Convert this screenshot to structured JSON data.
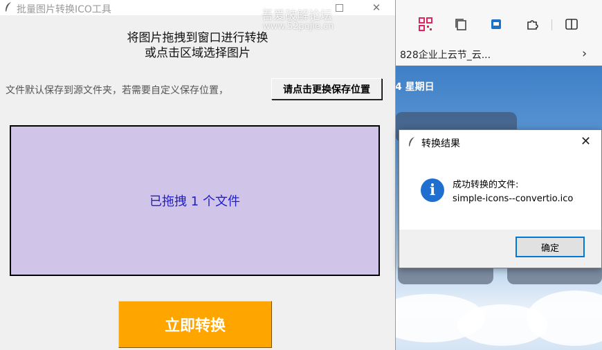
{
  "browser": {
    "bookmark_text": "828企业上云节_云...",
    "bookmark_more_icon": "chevron-right-icon",
    "date_text": "4 星期日"
  },
  "watermark": {
    "line1": "吾爱破解论坛",
    "line2": "www.52pojie.cn"
  },
  "app": {
    "title": "批量图片转换ICO工具",
    "instruction_line1": "将图片拖拽到窗口进行转换",
    "instruction_line2": "或点击区域选择图片",
    "save_hint": "文件默认保存到源文件夹，若需要自定义保存位置，",
    "save_button": "请点击更换保存位置",
    "drop_status": "已拖拽 1 个文件",
    "convert_button": "立即转换",
    "drop_area_color": "#d0c4e8",
    "convert_color": "#ffa500"
  },
  "dialog": {
    "title": "转换结果",
    "message_line1": "成功转换的文件:",
    "message_line2": "simple-icons--convertio.ico",
    "ok_button": "确定",
    "icon": "info-icon"
  }
}
